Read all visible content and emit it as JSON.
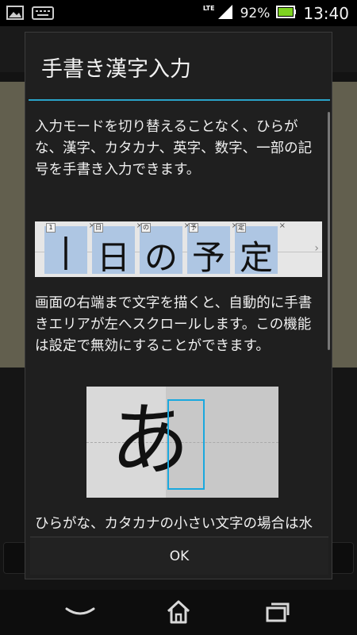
{
  "status_bar": {
    "network_type": "LTE",
    "battery_percent": "92%",
    "time": "13:40",
    "icons": [
      "image-icon",
      "keyboard-icon",
      "signal-icon",
      "battery-icon"
    ]
  },
  "dialog": {
    "title": "手書き漢字入力",
    "paragraph1": "入力モードを切り替えることなく、ひらがな、漢字、カタカナ、英字、数字、一部の記号を手書き入力できます。",
    "example_strip": {
      "characters": [
        "|",
        "日",
        "の",
        "予",
        "定"
      ],
      "tags": [
        "1",
        "日",
        "の",
        "予",
        "定"
      ]
    },
    "paragraph2": "画面の右端まで文字を描くと、自動的に手書きエリアが左へスクロールします。この機能は設定で無効にすることができます。",
    "handwriting_example": {
      "character": "あ"
    },
    "paragraph3": "ひらがな、カタカナの小さい文字の場合は水平の罫線より下のエリアに描いてく",
    "ok_label": "OK"
  },
  "colors": {
    "accent": "#2aa3c8",
    "dialog_bg": "#1f1f1f",
    "highlight_cell": "#aec6e3"
  },
  "navbar": {
    "icons": [
      "back-icon",
      "home-icon",
      "recent-apps-icon"
    ]
  }
}
